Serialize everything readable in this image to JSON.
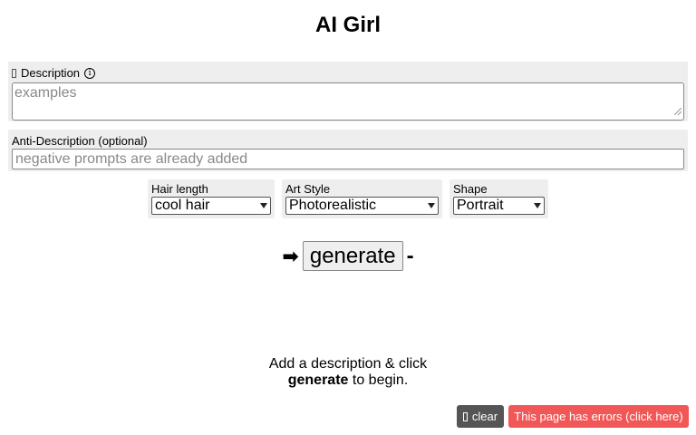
{
  "page": {
    "title": "AI Girl"
  },
  "description": {
    "label": "Description",
    "info_symbol": "i",
    "placeholder": "examples"
  },
  "anti_description": {
    "label": "Anti-Description (optional)",
    "placeholder": "negative prompts are already added"
  },
  "selects": {
    "hair_length": {
      "label": "Hair length",
      "value": "cool hair"
    },
    "art_style": {
      "label": "Art Style",
      "value": "Photorealistic"
    },
    "shape": {
      "label": "Shape",
      "value": "Portrait"
    }
  },
  "generate": {
    "left_symbol": "➡",
    "label": "generate",
    "right_symbol": "-"
  },
  "hint": {
    "line1": "Add a description & click",
    "bold": "generate",
    "line2_rest": " to begin."
  },
  "footer": {
    "clear_label": "clear",
    "errors_label": "This page has errors (click here)"
  },
  "colors": {
    "panel_bg": "#eeeeee",
    "clear_bg": "#555555",
    "errors_bg": "#f25757"
  }
}
